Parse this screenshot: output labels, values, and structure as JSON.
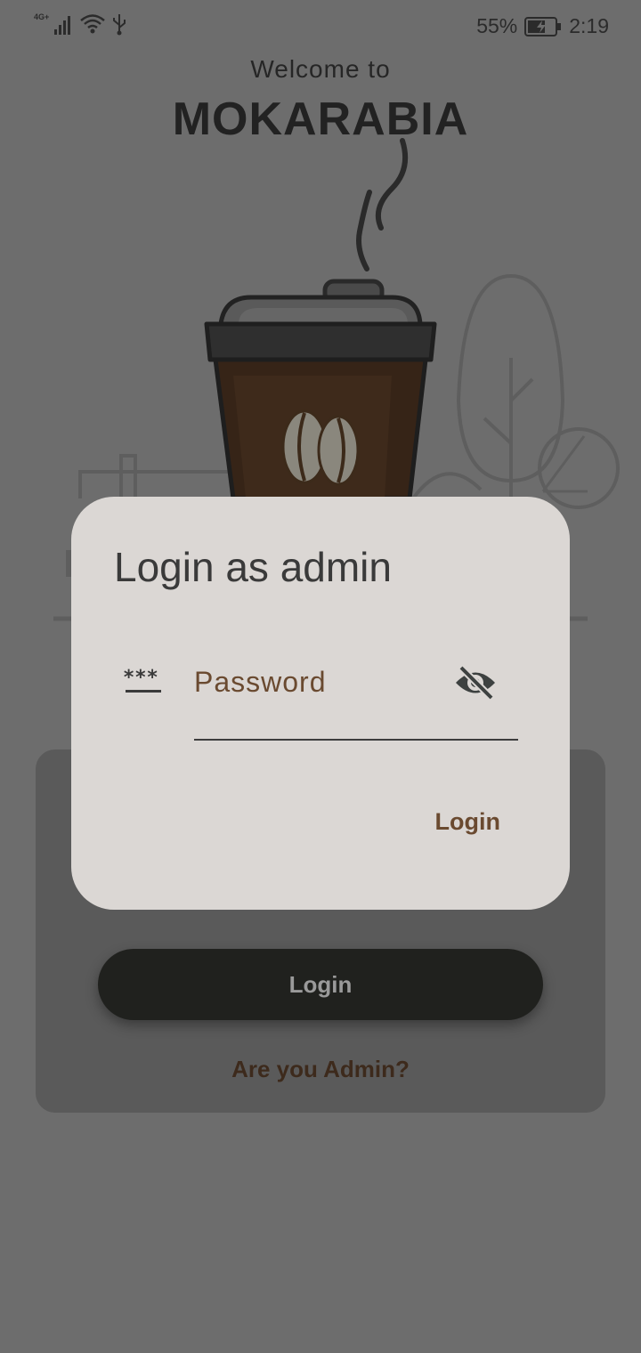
{
  "status_bar": {
    "network_label": "4G+",
    "battery_percent": "55%",
    "time": "2:19",
    "icons": [
      "signal-icon",
      "wifi-icon",
      "usb-icon",
      "battery-charging-icon"
    ]
  },
  "header": {
    "welcome": "Welcome to",
    "app_name": "MOKARABIA"
  },
  "background_card": {
    "login_label": "Login",
    "admin_link": "Are you Admin?"
  },
  "dialog": {
    "title": "Login as admin",
    "password_placeholder": "Password",
    "password_value": "",
    "password_icon": "password-icon",
    "visibility_icon": "visibility-off-icon",
    "login_label": "Login"
  },
  "colors": {
    "scrim_background": "#6d6d6d",
    "dialog_background": "#dbd7d4",
    "accent_brown": "#6a4a30",
    "dark_button": "#20211e"
  }
}
